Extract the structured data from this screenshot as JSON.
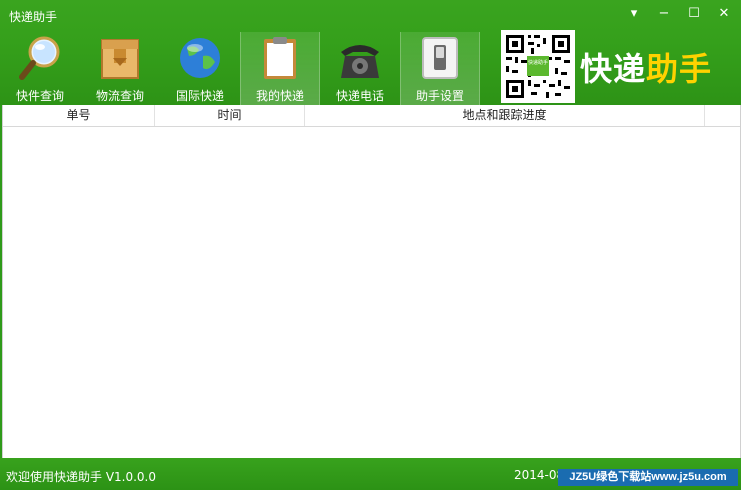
{
  "window": {
    "title": "快递助手",
    "controls": [
      "menu-dropdown",
      "minimize",
      "maximize",
      "close"
    ],
    "control_glyphs": {
      "menu": "▾",
      "minimize": "−",
      "maximize": "☐",
      "close": "✕"
    }
  },
  "toolbar": {
    "items": [
      {
        "label": "快件查询",
        "icon": "magnifier-icon"
      },
      {
        "label": "物流查询",
        "icon": "box-icon"
      },
      {
        "label": "国际快递",
        "icon": "globe-icon"
      },
      {
        "label": "我的快递",
        "icon": "clipboard-icon"
      },
      {
        "label": "快递电话",
        "icon": "telephone-icon"
      },
      {
        "label": "助手设置",
        "icon": "switch-icon"
      }
    ],
    "active_index": 3
  },
  "brand": {
    "part1": "快递",
    "part2": "助手"
  },
  "qr": {
    "center_label": "快递助手"
  },
  "table": {
    "columns": [
      "单号",
      "时间",
      "地点和跟踪进度"
    ],
    "rows": []
  },
  "status": {
    "left": "欢迎使用快递助手 V1.0.0.0",
    "date": "2014-08"
  },
  "watermark": "JZ5U绿色下载站www.jz5u.com",
  "colors": {
    "accent_green": "#35a01b",
    "brand_yellow": "#ffd200",
    "watermark_blue": "#1a6cb0"
  }
}
